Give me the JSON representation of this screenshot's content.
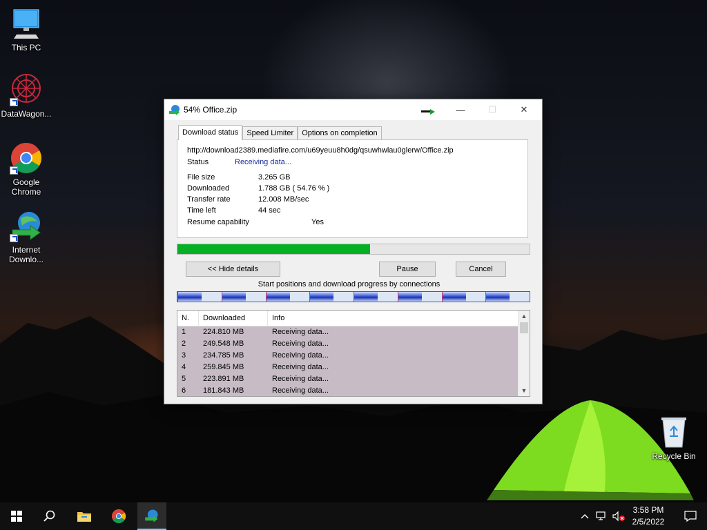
{
  "desktop": {
    "icons": [
      {
        "label": "This PC"
      },
      {
        "label": "DataWagon..."
      },
      {
        "label": "Google Chrome"
      },
      {
        "label": "Internet Downlo..."
      }
    ],
    "recycle_bin": "Recycle Bin"
  },
  "window": {
    "title": "54% Office.zip",
    "controls": {
      "minimize": "—",
      "maximize": "☐",
      "close": "✕"
    },
    "tabs": [
      "Download status",
      "Speed Limiter",
      "Options on completion"
    ],
    "url": "http://download2389.mediafire.com/u69yeuu8h0dg/qsuwhwlau0glerw/Office.zip",
    "status": {
      "label": "Status",
      "value": "Receiving data..."
    },
    "file_size": {
      "label": "File size",
      "value": "3.265  GB"
    },
    "downloaded": {
      "label": "Downloaded",
      "value": "1.788  GB  ( 54.76 % )"
    },
    "transfer_rate": {
      "label": "Transfer rate",
      "value": "12.008  MB/sec"
    },
    "time_left": {
      "label": "Time left",
      "value": "44 sec"
    },
    "resume": {
      "label": "Resume capability",
      "value": "Yes"
    },
    "progress_percent": 54.76,
    "buttons": {
      "hide_details": "<< Hide details",
      "pause": "Pause",
      "cancel": "Cancel"
    },
    "connections_caption": "Start positions and download progress by connections",
    "connections_progress": [
      0.55,
      0.55,
      0.55,
      0.55,
      0.55,
      0.55,
      0.55,
      0.55
    ],
    "list": {
      "columns": [
        "N.",
        "Downloaded",
        "Info"
      ],
      "rows": [
        {
          "n": "1",
          "downloaded": "224.810  MB",
          "info": "Receiving data..."
        },
        {
          "n": "2",
          "downloaded": "249.548  MB",
          "info": "Receiving data..."
        },
        {
          "n": "3",
          "downloaded": "234.785  MB",
          "info": "Receiving data..."
        },
        {
          "n": "4",
          "downloaded": "259.845  MB",
          "info": "Receiving data..."
        },
        {
          "n": "5",
          "downloaded": "223.891  MB",
          "info": "Receiving data..."
        },
        {
          "n": "6",
          "downloaded": "181.843  MB",
          "info": "Receiving data..."
        }
      ]
    }
  },
  "taskbar": {
    "clock_time": "3:58 PM",
    "clock_date": "2/5/2022",
    "icons": [
      "windows-start-icon",
      "search-icon",
      "file-explorer-icon",
      "chrome-icon",
      "internet-download-manager-icon"
    ]
  },
  "colors": {
    "progress_fill": "#06b025",
    "status_text": "#1a2a9a",
    "list_selected_bg": "#c7bcc5"
  }
}
